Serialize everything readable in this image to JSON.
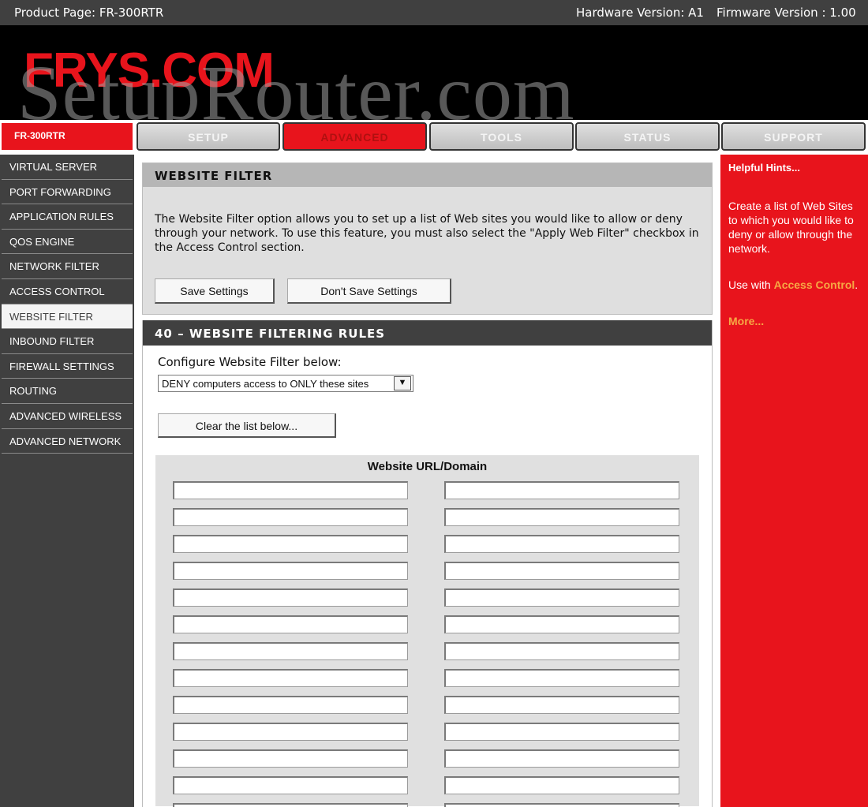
{
  "topbar": {
    "product": "Product Page: FR-300RTR",
    "hardware": "Hardware Version: A1",
    "firmware": "Firmware Version : 1.00"
  },
  "banner": {
    "logo": "FRYS.COM",
    "watermark": "SetupRouter.com"
  },
  "tabs": {
    "model": "FR-300RTR",
    "items": [
      {
        "label": "SETUP"
      },
      {
        "label": "ADVANCED",
        "active": true
      },
      {
        "label": "TOOLS"
      },
      {
        "label": "STATUS"
      },
      {
        "label": "SUPPORT"
      }
    ]
  },
  "sidebar": {
    "items": [
      {
        "label": "VIRTUAL SERVER"
      },
      {
        "label": "PORT FORWARDING"
      },
      {
        "label": "APPLICATION RULES"
      },
      {
        "label": "QOS ENGINE"
      },
      {
        "label": "NETWORK FILTER"
      },
      {
        "label": "ACCESS CONTROL"
      },
      {
        "label": "WEBSITE FILTER",
        "active": true
      },
      {
        "label": "INBOUND FILTER"
      },
      {
        "label": "FIREWALL SETTINGS"
      },
      {
        "label": "ROUTING"
      },
      {
        "label": "ADVANCED WIRELESS"
      },
      {
        "label": "ADVANCED NETWORK"
      }
    ]
  },
  "main": {
    "title": "WEBSITE FILTER",
    "description": "The Website Filter option allows you to set up a list of Web sites you would like to allow or deny through your network. To use this feature, you must also select the \"Apply Web Filter\" checkbox in the Access Control section.",
    "save_label": "Save Settings",
    "dont_save_label": "Don't Save Settings",
    "rules_title": "40 – WEBSITE FILTERING RULES",
    "config_label": "Configure Website Filter below:",
    "select_value": "DENY computers access to ONLY these sites",
    "clear_label": "Clear the list below...",
    "url_header": "Website URL/Domain"
  },
  "hints": {
    "title": "Helpful Hints...",
    "text1": "Create a list of Web Sites to which you would like to deny or allow through the network.",
    "text2_prefix": "Use with ",
    "text2_link": "Access Control",
    "text2_suffix": ".",
    "more": "More..."
  },
  "colors": {
    "brand_red": "#e8141c",
    "dark_gray": "#404040",
    "hint_link": "#f6a844"
  }
}
